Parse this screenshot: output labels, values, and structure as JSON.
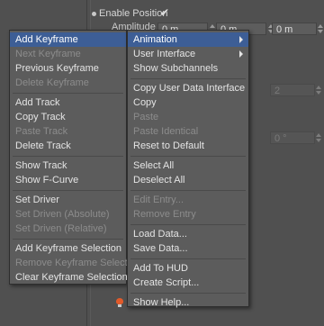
{
  "background": {
    "enable_position": {
      "label": "Enable Position",
      "checked": true
    },
    "amplitude": {
      "label": "Amplitude"
    },
    "fields": [
      "0 m",
      "0 m",
      "0 m"
    ],
    "disabled_value": "2",
    "disabled_angle": "0 °"
  },
  "left_menu": {
    "items": [
      {
        "label": "Add Keyframe",
        "enabled": true,
        "highlighted": true
      },
      {
        "label": "Next Keyframe",
        "enabled": false
      },
      {
        "label": "Previous Keyframe",
        "enabled": true
      },
      {
        "label": "Delete Keyframe",
        "enabled": false
      },
      {
        "separator": true
      },
      {
        "label": "Add Track",
        "enabled": true
      },
      {
        "label": "Copy Track",
        "enabled": true
      },
      {
        "label": "Paste Track",
        "enabled": false
      },
      {
        "label": "Delete Track",
        "enabled": true
      },
      {
        "separator": true
      },
      {
        "label": "Show Track",
        "enabled": true
      },
      {
        "label": "Show F-Curve",
        "enabled": true
      },
      {
        "separator": true
      },
      {
        "label": "Set Driver",
        "enabled": true
      },
      {
        "label": "Set Driven (Absolute)",
        "enabled": false
      },
      {
        "label": "Set Driven (Relative)",
        "enabled": false
      },
      {
        "separator": true
      },
      {
        "label": "Add Keyframe Selection",
        "enabled": true
      },
      {
        "label": "Remove Keyframe Selection",
        "enabled": false
      },
      {
        "label": "Clear Keyframe Selection",
        "enabled": true
      }
    ]
  },
  "right_menu": {
    "items": [
      {
        "label": "Animation",
        "enabled": true,
        "highlighted": true,
        "submenu": true
      },
      {
        "label": "User Interface",
        "enabled": true,
        "submenu": true
      },
      {
        "label": "Show Subchannels",
        "enabled": true
      },
      {
        "separator": true
      },
      {
        "label": "Copy User Data Interface",
        "enabled": true
      },
      {
        "label": "Copy",
        "enabled": true
      },
      {
        "label": "Paste",
        "enabled": false
      },
      {
        "label": "Paste Identical",
        "enabled": false
      },
      {
        "label": "Reset to Default",
        "enabled": true
      },
      {
        "separator": true
      },
      {
        "label": "Select All",
        "enabled": true
      },
      {
        "label": "Deselect All",
        "enabled": true
      },
      {
        "separator": true
      },
      {
        "label": "Edit Entry...",
        "enabled": false
      },
      {
        "label": "Remove Entry",
        "enabled": false
      },
      {
        "separator": true
      },
      {
        "label": "Load Data...",
        "enabled": true
      },
      {
        "label": "Save Data...",
        "enabled": true
      },
      {
        "separator": true
      },
      {
        "label": "Add To HUD",
        "enabled": true
      },
      {
        "label": "Create Script...",
        "enabled": true
      },
      {
        "separator": true
      },
      {
        "label": "Show Help...",
        "enabled": true,
        "icon": "help-lightbulb-icon"
      }
    ]
  },
  "colors": {
    "highlight": "#3d5e96",
    "menu_bg": "#5c5c5c",
    "panel_bg": "#505050"
  }
}
